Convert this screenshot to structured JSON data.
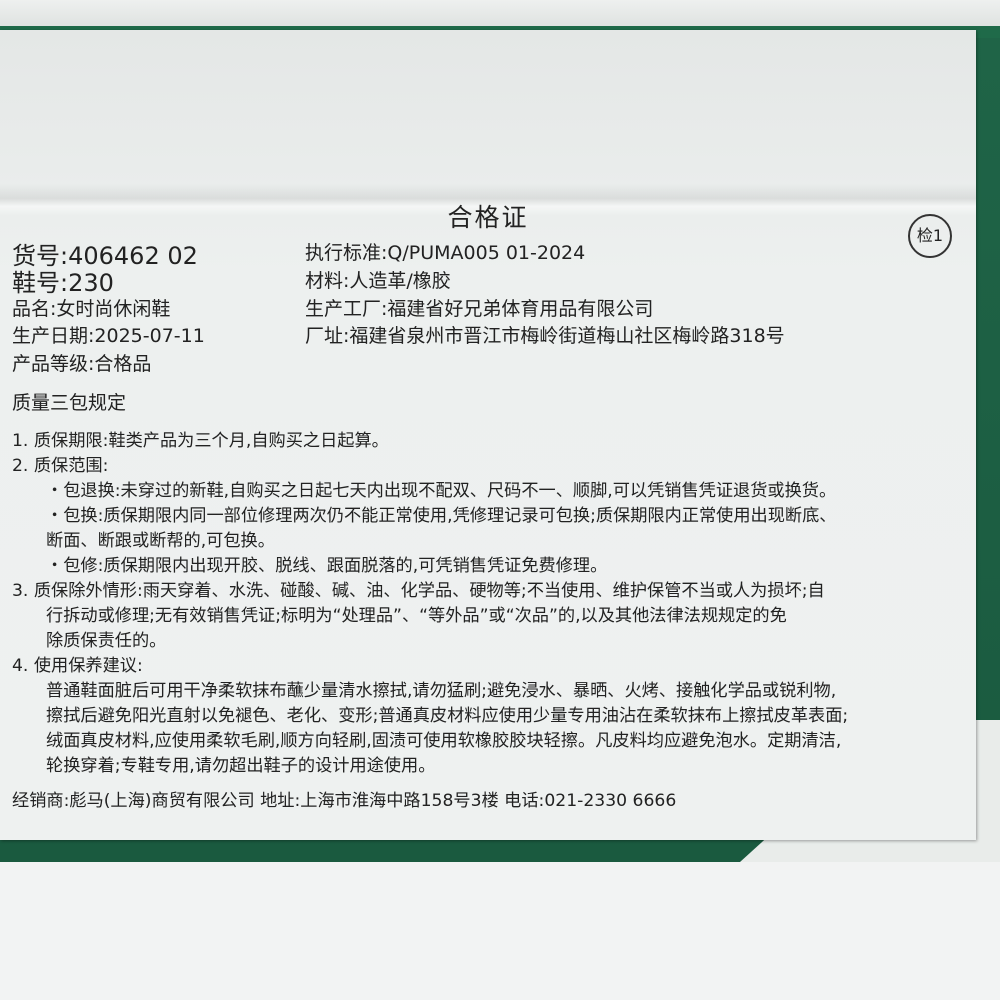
{
  "title": "合格证",
  "stamp": "检1",
  "left_fields": [
    {
      "label": "货号:",
      "value": "406462 02"
    },
    {
      "label": "鞋号:",
      "value": "230"
    },
    {
      "label": "品名:",
      "value": "女时尚休闲鞋"
    },
    {
      "label": "生产日期:",
      "value": "2025-07-11"
    },
    {
      "label": "产品等级:",
      "value": "合格品"
    }
  ],
  "right_fields": [
    {
      "label": "执行标准:",
      "value": "Q/PUMA005 01-2024"
    },
    {
      "label": "材料:",
      "value": "人造革/橡胶"
    },
    {
      "label": "生产工厂:",
      "value": "福建省好兄弟体育用品有限公司"
    },
    {
      "label": "厂址:",
      "value": "福建省泉州市晋江市梅岭街道梅山社区梅岭路318号"
    }
  ],
  "section_title": "质量三包规定",
  "lines": [
    "1. 质保期限:鞋类产品为三个月,自购买之日起算。",
    "2. 质保范围:",
    "・包退换:未穿过的新鞋,自购买之日起七天内出现不配双、尺码不一、顺脚,可以凭销售凭证退货或换货。",
    "・包换:质保期限内同一部位修理两次仍不能正常使用,凭修理记录可包换;质保期限内正常使用出现断底、",
    "断面、断跟或断帮的,可包换。",
    "・包修:质保期限内出现开胶、脱线、跟面脱落的,可凭销售凭证免费修理。",
    "3. 质保除外情形:雨天穿着、水洗、碰酸、碱、油、化学品、硬物等;不当使用、维护保管不当或人为损坏;自",
    "行拆动或修理;无有效销售凭证;标明为“处理品”、“等外品”或“次品”的,以及其他法律法规规定的免",
    "除质保责任的。",
    "4. 使用保养建议:",
    "普通鞋面脏后可用干净柔软抹布蘸少量清水擦拭,请勿猛刷;避免浸水、暴晒、火烤、接触化学品或锐利物,",
    "擦拭后避免阳光直射以免褪色、老化、变形;普通真皮材料应使用少量专用油沾在柔软抹布上擦拭皮革表面;",
    "绒面真皮材料,应使用柔软毛刷,顺方向轻刷,固渍可使用软橡胶胶块轻擦。凡皮料均应避免泡水。定期清洁,",
    "轮换穿着;专鞋专用,请勿超出鞋子的设计用途使用。"
  ],
  "footer": "经销商:彪马(上海)商贸有限公司  地址:上海市淮海中路158号3楼  电话:021-2330 6666"
}
